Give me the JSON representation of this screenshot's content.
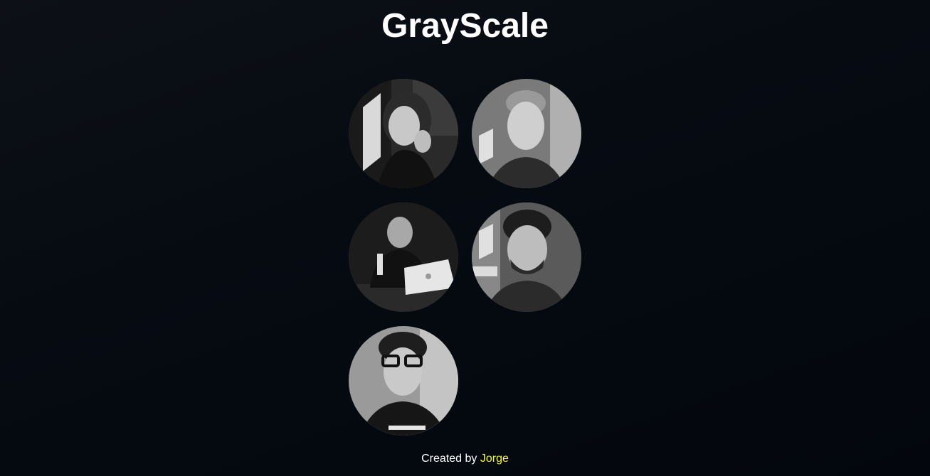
{
  "page": {
    "title": "GrayScale"
  },
  "gallery": {
    "photos": [
      {
        "name": "photo-1"
      },
      {
        "name": "photo-2"
      },
      {
        "name": "photo-3"
      },
      {
        "name": "photo-4"
      },
      {
        "name": "photo-5"
      }
    ]
  },
  "footer": {
    "prefix": "Created by ",
    "author": "Jorge"
  },
  "colors": {
    "background": "#060b12",
    "title": "#ffffff",
    "footer_text": "#ffffff",
    "author_link": "#f5f542"
  }
}
